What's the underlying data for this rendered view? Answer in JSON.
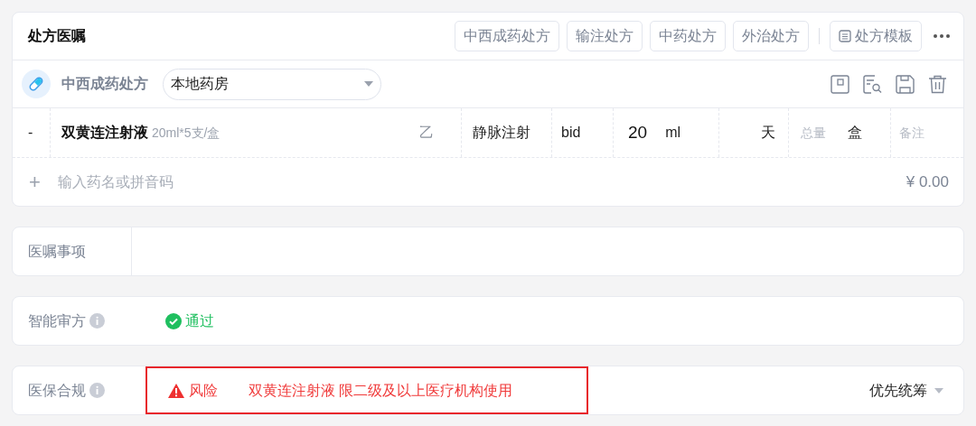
{
  "prescription": {
    "title": "处方医嘱",
    "type_buttons": [
      {
        "label": "中西成药处方"
      },
      {
        "label": "输注处方"
      },
      {
        "label": "中药处方"
      },
      {
        "label": "外治处方"
      }
    ],
    "template_button": "处方模板",
    "type_label": "中西成药处方",
    "pharmacy": "本地药房",
    "items": [
      {
        "remove": "-",
        "name": "双黄连注射液",
        "spec": "20ml*5支/盒",
        "grade": "乙",
        "route": "静脉注射",
        "frequency": "bid",
        "dose": "20",
        "dose_unit": "ml",
        "days_unit": "天",
        "total_label": "总量",
        "total_unit": "盒",
        "note_placeholder": "备注"
      }
    ],
    "add_row": {
      "icon": "+",
      "placeholder": "输入药名或拼音码",
      "amount": "¥ 0.00"
    }
  },
  "notes": {
    "label": "医嘱事项"
  },
  "checks": [
    {
      "label": "智能审方",
      "kind": "pass",
      "status": "通过"
    },
    {
      "label": "医保合规",
      "kind": "risk",
      "status": "风险",
      "message": "双黄连注射液 限二级及以上医疗机构使用",
      "payment": "优先统筹"
    }
  ]
}
